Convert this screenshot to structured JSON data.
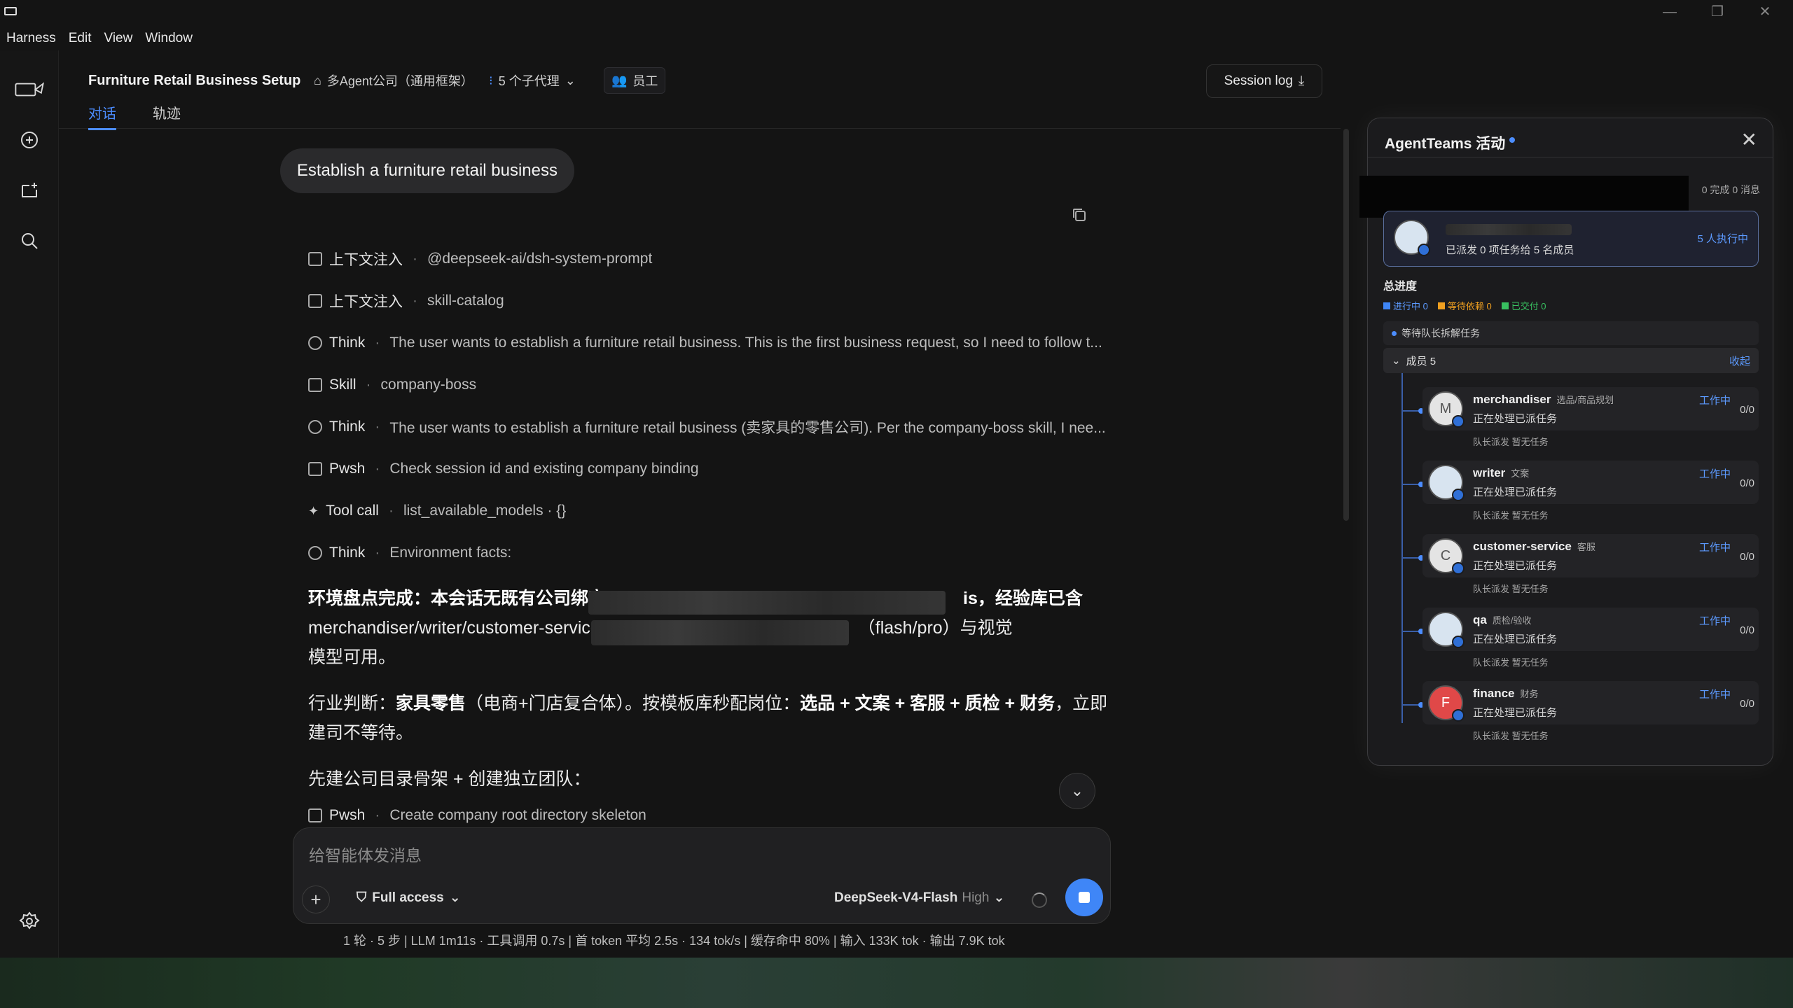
{
  "window": {
    "minimize": "—",
    "restore": "❐",
    "close": "✕"
  },
  "menu": [
    "Harness",
    "Edit",
    "View",
    "Window"
  ],
  "header": {
    "title": "Furniture Retail Business Setup",
    "company": "多Agent公司（通用框架）",
    "agents": "5 个子代理",
    "staff": "员工",
    "session_log": "Session log",
    "tabs": [
      "对话",
      "轨迹"
    ]
  },
  "chat": {
    "user_message": "Establish a furniture retail business",
    "steps": [
      {
        "label": "上下文注入",
        "value": "@deepseek-ai/dsh-system-prompt",
        "icon": "doc-icon"
      },
      {
        "label": "上下文注入",
        "value": "skill-catalog",
        "icon": "doc-icon"
      },
      {
        "label": "Think",
        "value": "The user wants to establish a furniture retail business. This is the first business request, so I need to follow t...",
        "icon": "brain-icon"
      },
      {
        "label": "Skill",
        "value": "company-boss",
        "icon": "skill-icon"
      },
      {
        "label": "Think",
        "value": "The user wants to establish a furniture retail business (卖家具的零售公司). Per the company-boss skill, I nee...",
        "icon": "brain-icon"
      },
      {
        "label": "Pwsh",
        "value": "Check session id and existing company binding",
        "icon": "terminal-icon"
      },
      {
        "label": "Tool call",
        "value": "list_available_models · {}",
        "icon": "sparkle-icon"
      },
      {
        "label": "Think",
        "value": "Environment facts:",
        "icon": "brain-icon"
      }
    ],
    "para1_a": "环境盘点完成：本会话无既有公司绑定",
    "para1_b": "is，经验库已含",
    "para1_c": "merchandiser/writer/customer-service",
    "para1_d": "（flash/pro）与视觉",
    "para1_e": "模型可用。",
    "para2_prefix": "行业判断：",
    "para2_bold1": "家具零售",
    "para2_mid": "（电商+门店复合体）。按模板库秒配岗位：",
    "para2_bold2": "选品 + 文案 + 客服 + 质检 + 财务",
    "para2_suffix": "，立即",
    "para2_line2": "建司不等待。",
    "para3": "先建公司目录骨架 + 创建独立团队：",
    "last_step": {
      "label": "Pwsh",
      "value": "Create company root directory skeleton"
    }
  },
  "composer": {
    "placeholder": "给智能体发消息",
    "access": "Full access",
    "model": "DeepSeek-V4-Flash",
    "level": "High"
  },
  "status_line": "1 轮 · 5 步   |   LLM 1m11s · 工具调用 0.7s   |   首 token 平均 2.5s · 134 tok/s   |   缓存命中 80%   |   输入 133K tok · 输出 7.9K tok",
  "panel": {
    "title": "AgentTeams 活动",
    "stats": "0 完成  0 消息",
    "lead_sub": "已派发 0 项任务给 5 名成员",
    "lead_run": "5 人执行中",
    "progress_label": "总进度",
    "legend": [
      {
        "label": "进行中 0",
        "color": "#3f86f7"
      },
      {
        "label": "等待依赖 0",
        "color": "#f0a020"
      },
      {
        "label": "已交付 0",
        "color": "#38c060"
      }
    ],
    "waiting": "等待队长拆解任务",
    "members_label": "成员 5",
    "collapse": "收起",
    "members": [
      {
        "name": "merchandiser",
        "role": "选品/商品规划",
        "state": "正在处理已派任务",
        "work": "工作中",
        "count": "0/0",
        "meta": "队长派发   暂无任务",
        "initial": "M",
        "style": "plain"
      },
      {
        "name": "writer",
        "role": "文案",
        "state": "正在处理已派任务",
        "work": "工作中",
        "count": "0/0",
        "meta": "队长派发   暂无任务",
        "initial": "",
        "style": "dark"
      },
      {
        "name": "customer-service",
        "role": "客服",
        "state": "正在处理已派任务",
        "work": "工作中",
        "count": "0/0",
        "meta": "队长派发   暂无任务",
        "initial": "C",
        "style": "plain"
      },
      {
        "name": "qa",
        "role": "质检/验收",
        "state": "正在处理已派任务",
        "work": "工作中",
        "count": "0/0",
        "meta": "队长派发   暂无任务",
        "initial": "",
        "style": "dark"
      },
      {
        "name": "finance",
        "role": "财务",
        "state": "正在处理已派任务",
        "work": "工作中",
        "count": "0/0",
        "meta": "队长派发   暂无任务",
        "initial": "F",
        "style": "red"
      }
    ]
  }
}
